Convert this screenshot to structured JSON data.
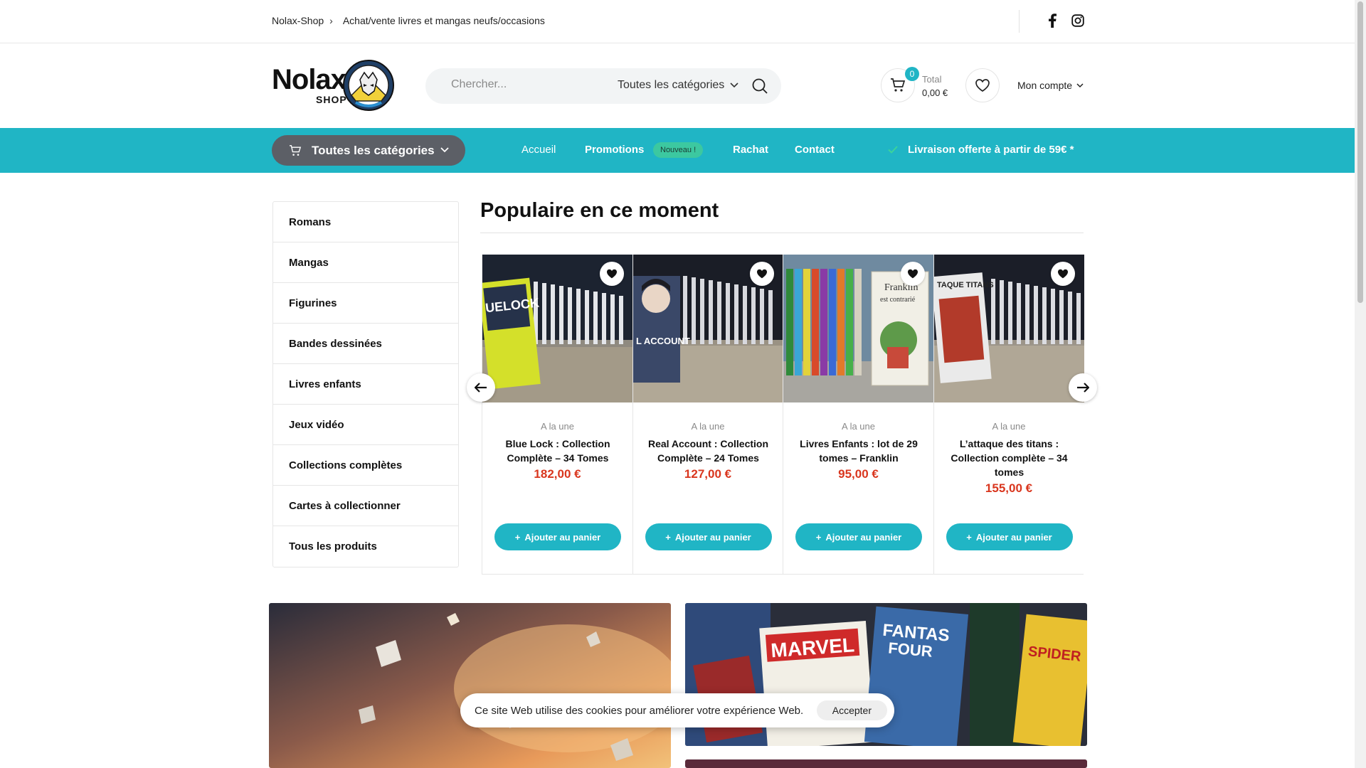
{
  "topbar": {
    "breadcrumb_home": "Nolax-Shop",
    "tagline": "Achat/vente livres et mangas neufs/occasions",
    "social": [
      "facebook-icon",
      "instagram-icon"
    ]
  },
  "header": {
    "logo_text": "Nolax",
    "logo_sub": "SHOP",
    "search_placeholder": "Chercher...",
    "search_category": "Toutes les catégories",
    "cart_count": "0",
    "total_label": "Total",
    "total_value": "0,00 €",
    "account_label": "Mon compte"
  },
  "nav": {
    "all_categories": "Toutes les catégories",
    "links": [
      "Accueil",
      "Promotions",
      "Rachat",
      "Contact"
    ],
    "new_badge": "Nouveau !",
    "shipping": "Livraison offerte à partir de 59€ *"
  },
  "sidebar": {
    "items": [
      "Romans",
      "Mangas",
      "Figurines",
      "Bandes dessinées",
      "Livres enfants",
      "Jeux vidéo",
      "Collections complètes",
      "Cartes à collectionner",
      "Tous les produits"
    ]
  },
  "popular": {
    "title": "Populaire en ce moment",
    "products": [
      {
        "tag": "A la une",
        "name": "Blue Lock : Collection Complète – 34 Tomes",
        "price": "182,00 €",
        "button": "Ajouter au panier"
      },
      {
        "tag": "A la une",
        "name": "Real Account : Collection Complète – 24 Tomes",
        "price": "127,00 €",
        "button": "Ajouter au panier"
      },
      {
        "tag": "A la une",
        "name": "Livres Enfants : lot de 29 tomes – Franklin",
        "price": "95,00 €",
        "button": "Ajouter au panier"
      },
      {
        "tag": "A la une",
        "name": "L’attaque des titans : Collection complète – 34 tomes",
        "price": "155,00 €",
        "button": "Ajouter au panier"
      }
    ]
  },
  "cookie": {
    "message": "Ce site Web utilise des cookies pour améliorer votre expérience Web.",
    "accept": "Accepter"
  },
  "colors": {
    "accent": "#20b5c5",
    "price": "#d9361e",
    "dark_button": "#5c5f66"
  }
}
